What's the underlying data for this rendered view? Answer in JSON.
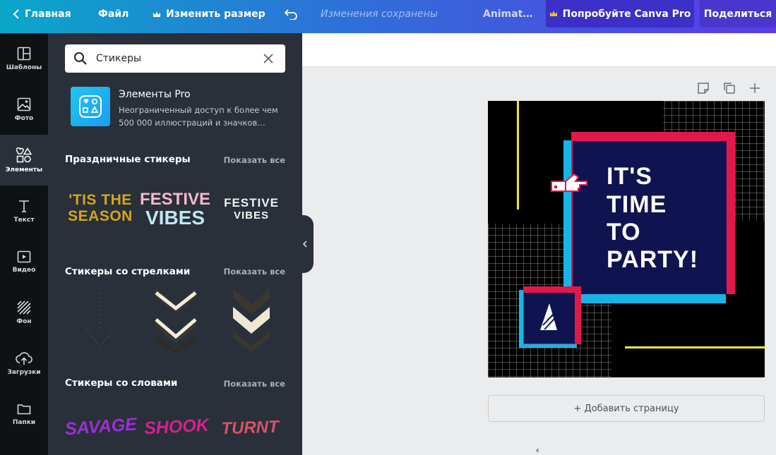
{
  "topbar": {
    "home": "Главная",
    "file": "Файл",
    "resize": "Изменить размер",
    "saved": "Изменения сохранены",
    "animate": "Animat…",
    "try_pro": "Попробуйте Canva Pro",
    "share": "Поделиться"
  },
  "rail": [
    {
      "label": "Шаблоны",
      "icon": "templates-icon"
    },
    {
      "label": "Фото",
      "icon": "photo-icon"
    },
    {
      "label": "Элементы",
      "icon": "elements-icon",
      "active": true
    },
    {
      "label": "Текст",
      "icon": "text-icon"
    },
    {
      "label": "Видео",
      "icon": "video-icon"
    },
    {
      "label": "Фон",
      "icon": "background-icon"
    },
    {
      "label": "Загрузки",
      "icon": "upload-icon"
    },
    {
      "label": "Папки",
      "icon": "folder-icon"
    }
  ],
  "panel": {
    "search": {
      "value": "Стикеры",
      "placeholder": ""
    },
    "pro": {
      "title": "Элементы Pro",
      "desc": "Неограниченный доступ к более чем 500 000 иллюстраций и значков…"
    },
    "sections": [
      {
        "title": "Праздничные стикеры",
        "show_all": "Показать все",
        "items": [
          {
            "line1": "'TIS THE",
            "line2": "SEASON"
          },
          {
            "line1": "FESTIVE",
            "line2": "VIBES"
          },
          {
            "line1": "FESTIVE",
            "line2": "VIBES"
          }
        ]
      },
      {
        "title": "Стикеры со стрелками",
        "show_all": "Показать все"
      },
      {
        "title": "Стикеры со словами",
        "show_all": "Показать все",
        "items": [
          {
            "text": "SAVAGE"
          },
          {
            "text": "SHOOK"
          },
          {
            "text": "TURNT"
          }
        ]
      }
    ]
  },
  "canvas": {
    "headline": [
      "IT'S",
      "TIME",
      "TO",
      "PARTY!"
    ]
  },
  "add_page": "+ Добавить страницу",
  "colors": {
    "panel": "#293039",
    "rail": "#0f1215",
    "accent_pink": "#e2184a",
    "accent_blue": "#18b4e5",
    "navy": "#0f1450",
    "yellow": "#f5e637"
  }
}
